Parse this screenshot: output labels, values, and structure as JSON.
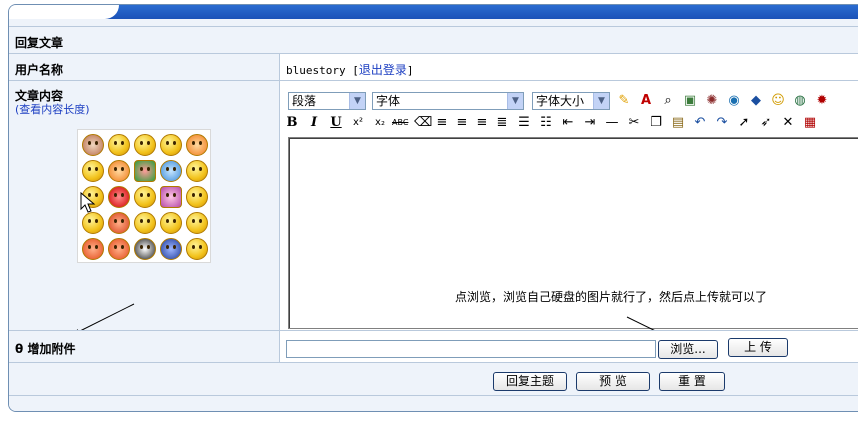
{
  "form": {
    "title": "回复文章",
    "username_label": "用户名称",
    "username": "bluestory",
    "bracket_open": "[",
    "logout_link": "退出登录",
    "bracket_close": "]",
    "content_label": "文章内容",
    "view_length_open": "(",
    "view_length_link": "查看内容长度",
    "view_length_close": ")",
    "attach_glyph": "θ",
    "attach_label": "增加附件",
    "hint_text": "点浏览，浏览自己硬盘的图片就行了，然后点上传就可以了"
  },
  "toolbar": {
    "paragraph_select": "段落",
    "font_select": "字体",
    "size_select": "字体大小",
    "bold": "B",
    "italic": "I",
    "underline": "U"
  },
  "buttons": {
    "browse": "浏览...",
    "upload": "上 传",
    "reply": "回复主题",
    "preview": "预 览",
    "reset": "重 置"
  }
}
